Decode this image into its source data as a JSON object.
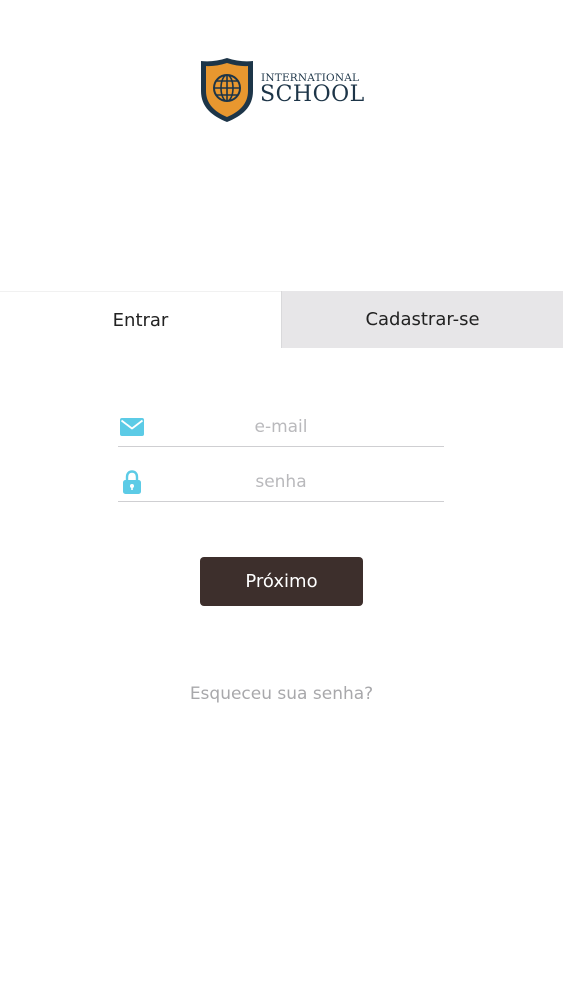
{
  "logo": {
    "line1": "INTERNATIONAL",
    "line2": "SCHOOL",
    "emblem_icon": "globe-shield-icon",
    "colors": {
      "shield_outer": "#1d3548",
      "shield_inner": "#e8972f"
    }
  },
  "tabs": [
    {
      "label": "Entrar",
      "active": true
    },
    {
      "label": "Cadastrar-se",
      "active": false
    }
  ],
  "form": {
    "email": {
      "placeholder": "e-mail",
      "value": "",
      "icon": "mail-icon"
    },
    "password": {
      "placeholder": "senha",
      "value": "",
      "icon": "lock-icon"
    },
    "icon_color": "#5ccbe6",
    "next_button": {
      "label": "Próximo",
      "color": "#3d2f2c"
    }
  },
  "forgot_password": {
    "label": "Esqueceu sua senha?"
  }
}
